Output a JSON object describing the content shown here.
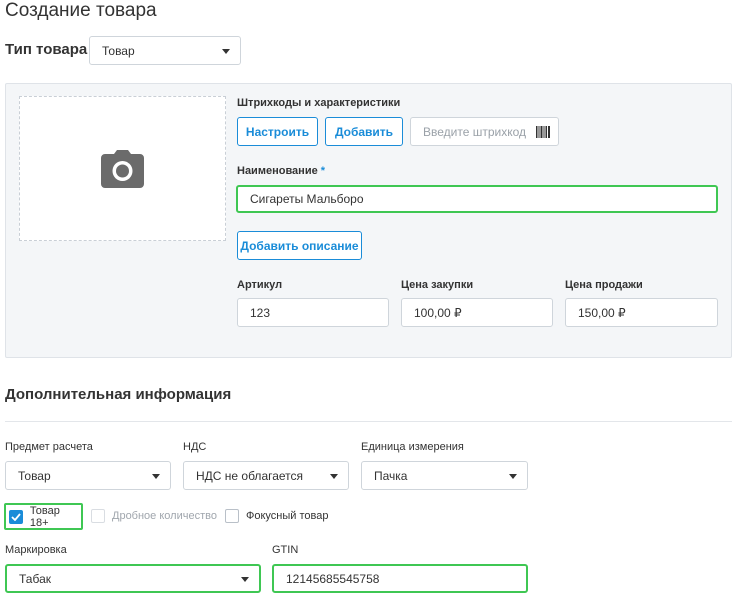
{
  "page_title": "Создание товара",
  "product_type": {
    "label": "Тип товара",
    "value": "Товар"
  },
  "barcodes": {
    "label": "Штрихкоды и характеристики",
    "configure_label": "Настроить",
    "add_label": "Добавить",
    "input_placeholder": "Введите штрихкод"
  },
  "name": {
    "label": "Наименование",
    "required_mark": "*",
    "value": "Сигареты Мальборо"
  },
  "add_description_label": "Добавить описание",
  "article": {
    "label": "Артикул",
    "value": "123"
  },
  "purchase_price": {
    "label": "Цена закупки",
    "value": "100,00 ₽"
  },
  "sale_price": {
    "label": "Цена продажи",
    "value": "150,00 ₽"
  },
  "additional": {
    "title": "Дополнительная информация",
    "calc_subject": {
      "label": "Предмет расчета",
      "value": "Товар"
    },
    "vat": {
      "label": "НДС",
      "value": "НДС не облагается"
    },
    "unit": {
      "label": "Единица измерения",
      "value": "Пачка"
    },
    "checkboxes": {
      "adult": {
        "label": "Товар 18+",
        "checked": true
      },
      "fractional": {
        "label": "Дробное количество",
        "checked": false,
        "disabled": true
      },
      "focus": {
        "label": "Фокусный товар",
        "checked": false
      }
    },
    "marking": {
      "label": "Маркировка",
      "value": "Табак"
    },
    "gtin": {
      "label": "GTIN",
      "value": "12145685545758"
    }
  },
  "colors": {
    "accent": "#1a8cd8",
    "highlight": "#3fc753"
  }
}
